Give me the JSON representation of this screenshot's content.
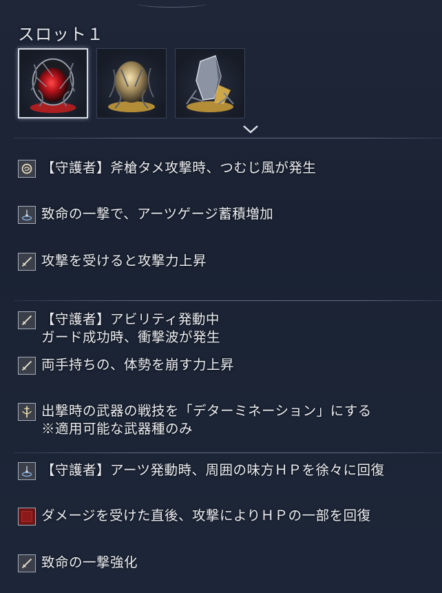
{
  "slot": {
    "title": "スロット１"
  },
  "relics": [
    {
      "name": "red-relic-icon",
      "color": "#c4202a",
      "selected": true
    },
    {
      "name": "yellow-relic-icon",
      "color": "#d9a83a",
      "selected": false
    },
    {
      "name": "crystal-relic-icon",
      "color": "#d9a83a",
      "selected": false
    }
  ],
  "effects": [
    {
      "icon": "tornado-icon",
      "lines": [
        "【守護者】斧槍タメ攻撃時、つむじ風が発生"
      ]
    },
    {
      "icon": "art-gauge-icon",
      "lines": [
        "致命の一撃で、アーツゲージ蓄積増加"
      ]
    },
    {
      "icon": "sword-icon",
      "lines": [
        "攻撃を受けると攻撃力上昇"
      ]
    },
    {
      "icon": "sword-icon",
      "lines": [
        "【守護者】アビリティ発動中",
        "ガード成功時、衝撃波が発生"
      ]
    },
    {
      "icon": "sword-icon",
      "lines": [
        "両手持ちの、体勢を崩す力上昇"
      ]
    },
    {
      "icon": "weapon-skill-icon",
      "lines": [
        "出撃時の武器の戦技を「デターミネーション」にする",
        "※適用可能な武器種のみ"
      ]
    },
    {
      "icon": "art-gauge-icon",
      "lines": [
        "【守護者】アーツ発動時、周囲の味方ＨＰを徐々に回復"
      ]
    },
    {
      "icon": "red-square-icon",
      "lines": [
        "ダメージを受けた直後、攻撃によりＨＰの一部を回復"
      ]
    },
    {
      "icon": "sword-icon",
      "lines": [
        "致命の一撃強化"
      ]
    }
  ]
}
